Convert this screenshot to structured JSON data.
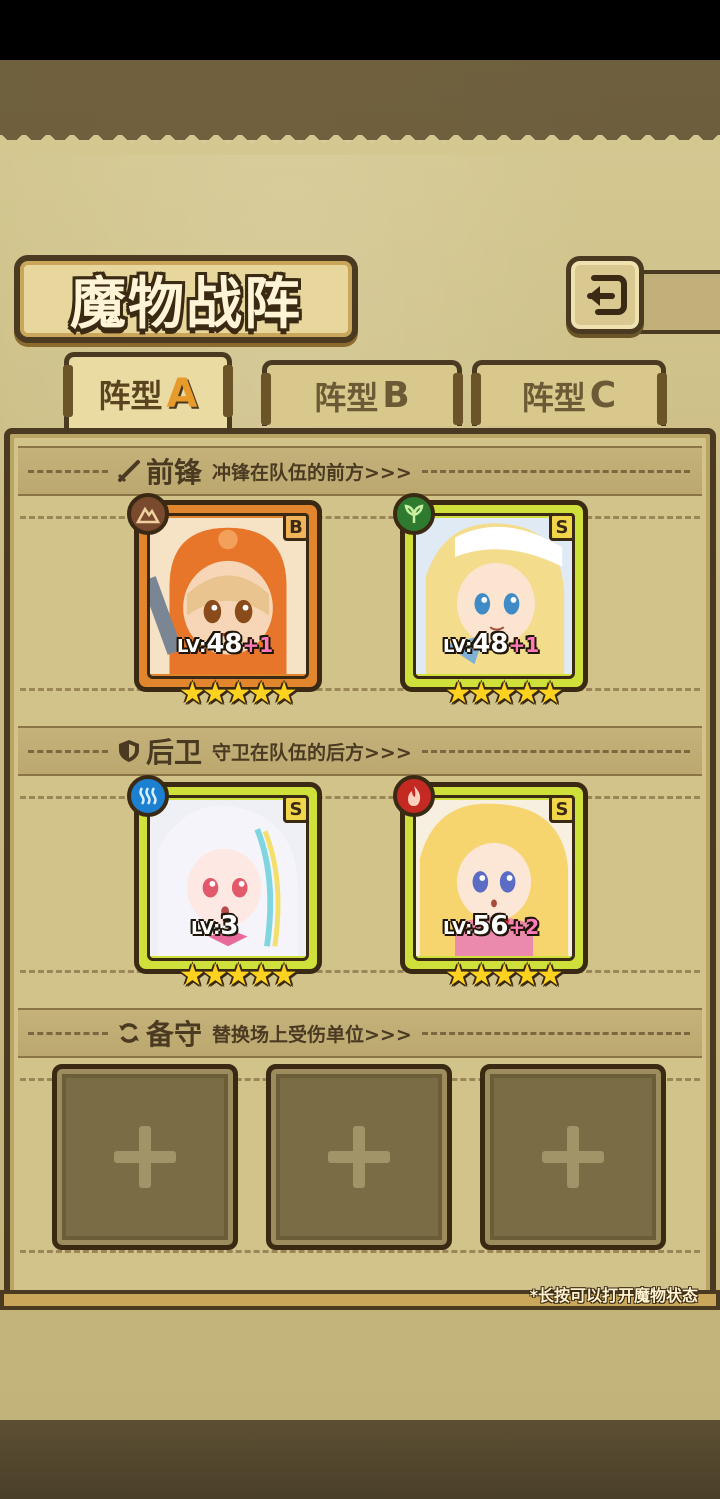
{
  "screen": {
    "title": "魔物战阵",
    "hint": "*长按可以打开魔物状态"
  },
  "tabs": [
    {
      "label": "阵型",
      "letter": "A",
      "active": true
    },
    {
      "label": "阵型",
      "letter": "B",
      "active": false
    },
    {
      "label": "阵型",
      "letter": "C",
      "active": false
    }
  ],
  "sections": {
    "front": {
      "title": "前锋",
      "subtitle": "冲锋在队伍的前方>>>",
      "icon": "sword-icon"
    },
    "back": {
      "title": "后卫",
      "subtitle": "守卫在队伍的后方>>>",
      "icon": "shield-icon"
    },
    "reserve": {
      "title": "备守",
      "subtitle": "替换场上受伤单位>>>",
      "icon": "swap-icon"
    }
  },
  "monsters": {
    "front": [
      {
        "lv_prefix": "LV:",
        "level": "48",
        "bonus": "+1",
        "rank": "B",
        "stars": 5,
        "element": "earth-icon",
        "element_color": "#7a4a2e",
        "frame_color": "#e2862d"
      },
      {
        "lv_prefix": "LV:",
        "level": "48",
        "bonus": "+1",
        "rank": "S",
        "stars": 5,
        "element": "leaf-icon",
        "element_color": "#2e7a2e",
        "frame_color": "#cfe03a"
      }
    ],
    "back": [
      {
        "lv_prefix": "LV:",
        "level": "3",
        "bonus": "",
        "rank": "S",
        "stars": 5,
        "element": "water-icon",
        "element_color": "#1d7fd0",
        "frame_color": "#cfe03a"
      },
      {
        "lv_prefix": "LV:",
        "level": "56",
        "bonus": "+2",
        "rank": "S",
        "stars": 5,
        "element": "fire-icon",
        "element_color": "#c42a22",
        "frame_color": "#cfe03a"
      }
    ]
  },
  "reserve_slots": [
    {
      "icon": "plus-icon"
    },
    {
      "icon": "plus-icon"
    },
    {
      "icon": "plus-icon"
    }
  ],
  "star_glyph": "★"
}
